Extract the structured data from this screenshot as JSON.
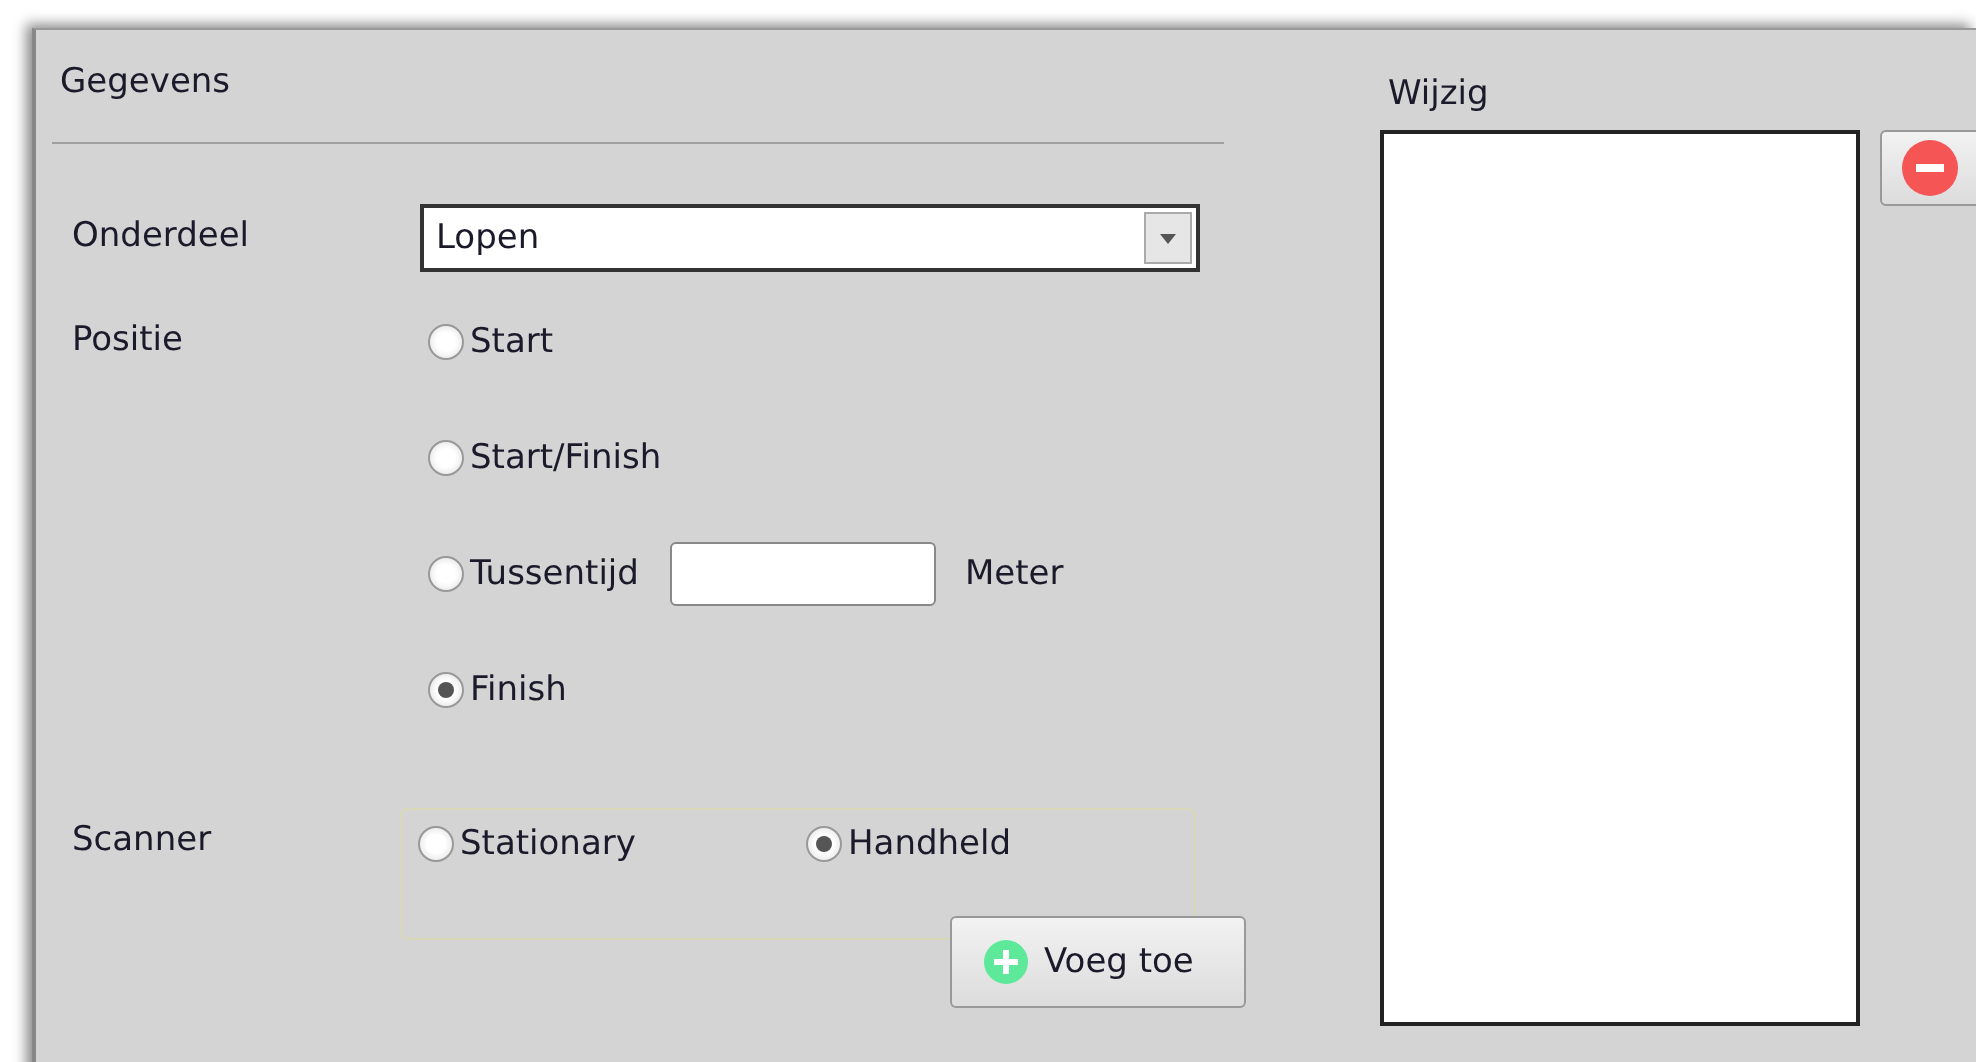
{
  "details": {
    "title": "Gegevens",
    "onderdeel": {
      "label": "Onderdeel",
      "value": "Lopen"
    },
    "positie": {
      "label": "Positie",
      "options": [
        {
          "label": "Start",
          "selected": false
        },
        {
          "label": "Start/Finish",
          "selected": false
        },
        {
          "label": "Tussentijd",
          "selected": false,
          "unit": "Meter"
        },
        {
          "label": "Finish",
          "selected": true
        }
      ]
    },
    "scanner": {
      "label": "Scanner",
      "options": [
        {
          "label": "Stationary",
          "selected": false
        },
        {
          "label": "Handheld",
          "selected": true
        }
      ]
    },
    "add_button": "Voeg toe"
  },
  "changes": {
    "title": "Wijzig"
  }
}
